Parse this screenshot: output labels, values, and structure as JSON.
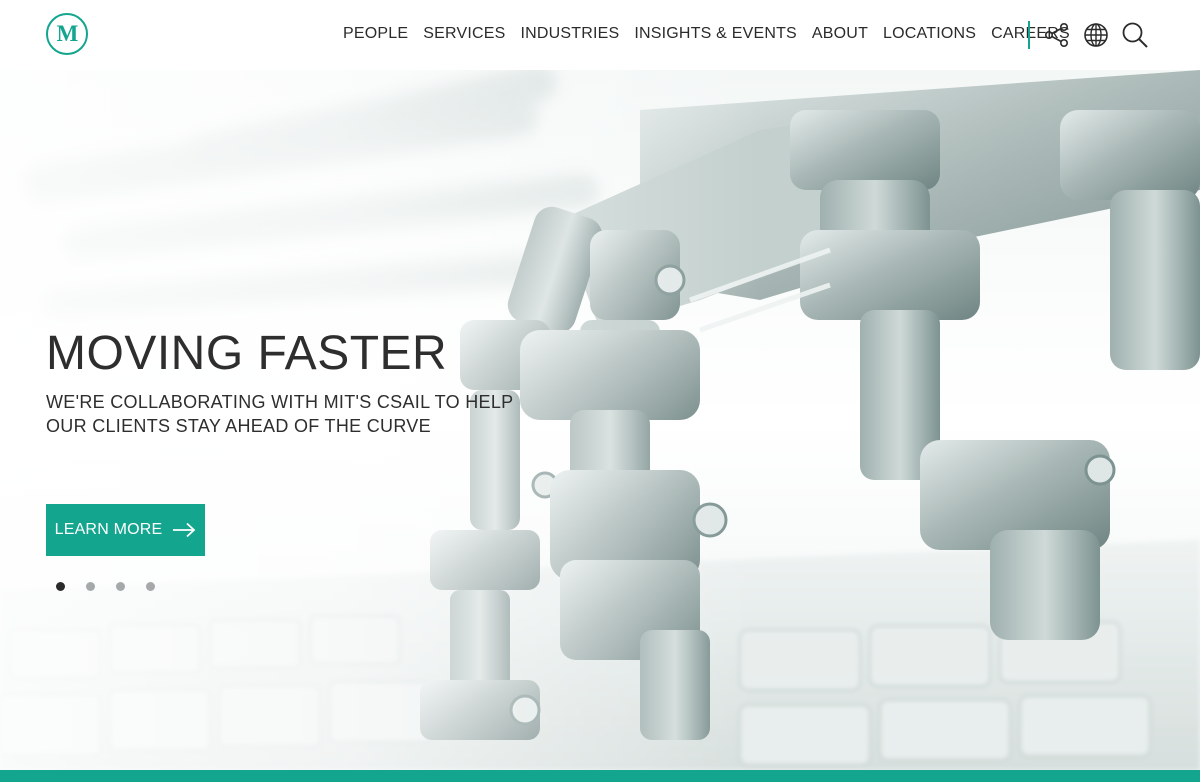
{
  "brand": {
    "logo_text": "M",
    "accent_color": "#13a58e"
  },
  "nav": {
    "items": [
      {
        "label": "PEOPLE"
      },
      {
        "label": "SERVICES"
      },
      {
        "label": "INDUSTRIES"
      },
      {
        "label": "INSIGHTS & EVENTS"
      },
      {
        "label": "ABOUT"
      },
      {
        "label": "LOCATIONS"
      },
      {
        "label": "CAREERS"
      }
    ],
    "icons": [
      "share-icon",
      "globe-icon",
      "search-icon"
    ]
  },
  "hero": {
    "title": "MOVING FASTER",
    "subtitle": "WE'RE COLLABORATING WITH MIT'S CSAIL TO HELP OUR CLIENTS STAY AHEAD OF THE CURVE",
    "cta_label": "LEARN MORE",
    "cta_icon": "arrow-right-icon",
    "image_subject": "robot-hand-over-keyboard",
    "slides_total": 4,
    "active_slide": 1
  }
}
